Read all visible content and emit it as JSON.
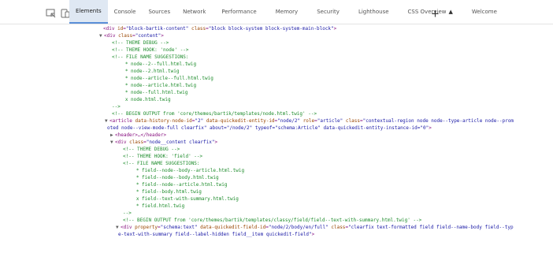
{
  "toolbar": {
    "tabs": [
      {
        "label": "Elements"
      },
      {
        "label": "Console"
      },
      {
        "label": "Sources"
      },
      {
        "label": "Network"
      },
      {
        "label": "Performance"
      },
      {
        "label": "Memory"
      },
      {
        "label": "Security"
      },
      {
        "label": "Lighthouse"
      },
      {
        "label": "CSS Overview",
        "badge": "▲"
      },
      {
        "label": "Welcome"
      }
    ],
    "add_tab": "+",
    "icons": [
      "inspect-element-icon",
      "device-toolbar-icon"
    ]
  },
  "dom": {
    "lines": [
      "<div id=\"block-bartik-content\" class=\"block block-system block-system-main-block\">",
      "<div class=\"content\">",
      "<!-- THEME DEBUG -->",
      "<!-- THEME HOOK: 'node' -->",
      "<!-- FILE NAME SUGGESTIONS:",
      "   * node--2--full.html.twig",
      "   * node--2.html.twig",
      "   * node--article--full.html.twig",
      "   * node--article.html.twig",
      "   * node--full.html.twig",
      "   x node.html.twig",
      "-->",
      "<!-- BEGIN OUTPUT from 'core/themes/bartik/templates/node.html.twig' -->",
      "<article data-history-node-id=\"2\" data-quickedit-entity-id=\"node/2\" role=\"article\" class=\"contextual-region node node--type-article node--prom",
      "oted node--view-mode-full clearfix\" about=\"/node/2\" typeof=\"schema:Article\" data-quickedit-entity-instance-id=\"0\">",
      "<header>…</header>",
      "<div class=\"node__content clearfix\">",
      "<!-- THEME DEBUG -->",
      "<!-- THEME HOOK: 'field' -->",
      "<!-- FILE NAME SUGGESTIONS:",
      "   * field--node--body--article.html.twig",
      "   * field--node--body.html.twig",
      "   * field--node--article.html.twig",
      "   * field--body.html.twig",
      "   x field--text-with-summary.html.twig",
      "   * field.html.twig",
      "-->",
      "<!-- BEGIN OUTPUT from 'core/themes/bartik/templates/classy/field/field--text-with-summary.html.twig' -->",
      "<div property=\"schema:text\" data-quickedit-field-id=\"node/2/body/en/full\" class=\"clearfix text-formatted field field--name-body field--typ",
      "e-text-with-summary field--label-hidden field__item quickedit-field\">"
    ]
  }
}
